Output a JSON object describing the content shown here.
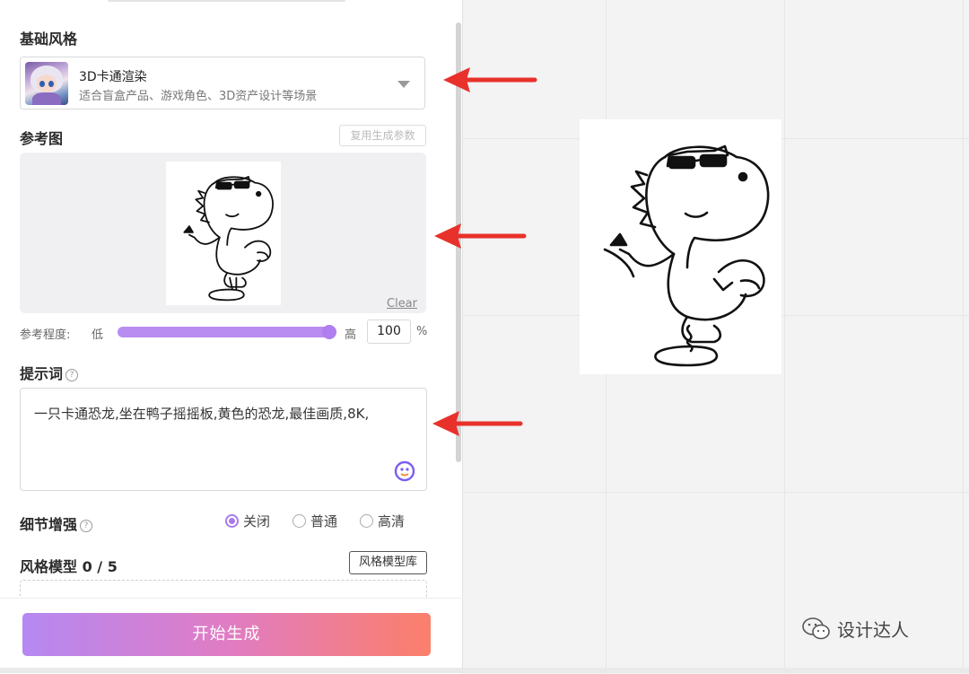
{
  "sidebar": {
    "base_style": {
      "title": "基础风格",
      "selected_name": "3D卡通渲染",
      "selected_desc": "适合盲盒产品、游戏角色、3D资产设计等场景"
    },
    "reference": {
      "title": "参考图",
      "reuse_label": "复用生成参数",
      "clear_label": "Clear",
      "strength_label": "参考程度:",
      "low_label": "低",
      "high_label": "高",
      "strength_value": "100",
      "unit": "%",
      "strength_fraction": 1.0
    },
    "prompt": {
      "title": "提示词",
      "help": "?",
      "text": "一只卡通恐龙,坐在鸭子摇摇板,黄色的恐龙,最佳画质,8K,"
    },
    "detail": {
      "title": "细节增强",
      "help": "?",
      "options": [
        "关闭",
        "普通",
        "高清"
      ],
      "selected": "关闭"
    },
    "style_model": {
      "title": "风格模型",
      "count": "0 / 5",
      "library_label": "风格模型库"
    },
    "generate_label": "开始生成"
  },
  "watermark": "设计达人",
  "colors": {
    "accent": "#b07eef",
    "arrow": "#e8312b",
    "gradient_start": "#b588f2",
    "gradient_end": "#fb7f6a"
  }
}
